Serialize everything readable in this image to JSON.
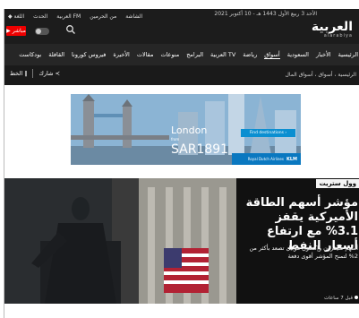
{
  "topbar": {
    "util_links": [
      "اللغة",
      "الحدث",
      "العربية FM",
      "من الحرمين",
      "الشاشة"
    ],
    "date": "الأحد 3 ربيع الأول 1443 هـ - 10 أكتوبر 2021",
    "live_label": "مباشر",
    "logo_ar": "العربية",
    "logo_en": "alarabiya"
  },
  "nav": {
    "items": [
      "الرئيسية",
      "الأخبار",
      "السعودية",
      "أسواق",
      "رياضة",
      "العربية TV",
      "البرامج",
      "منوعات",
      "مقالات",
      "الأخيرة",
      "فيروس كورونا",
      "القافلة",
      "بودكاست"
    ],
    "active_index": 3
  },
  "subbar": {
    "breadcrumb": "الرئيسية ، أسواق ، أسواق المال",
    "share_label": "شارك",
    "font_label": "الخط"
  },
  "ad": {
    "city": "London",
    "from": "from",
    "price": "SAR1891",
    "cta": "Find destinations ›",
    "airline": "Royal Dutch Airlines",
    "brand": "KLM"
  },
  "article": {
    "kicker": "وول ستريت",
    "headline": "مؤشر أسهم الطاقة الأميركية يقفز 3.1% مع ارتفاع أسعار النفط",
    "summary": "أسهم شيفرون وإكسون موبيل تصعد بأكثر من 2% لتمنح المؤشر أقوى دفعة",
    "time": "قبل 7 ساعات"
  },
  "colors": {
    "top": "#1c1c1c",
    "nav": "#262626",
    "live": "#e00000",
    "klm": "#0a78c0"
  }
}
